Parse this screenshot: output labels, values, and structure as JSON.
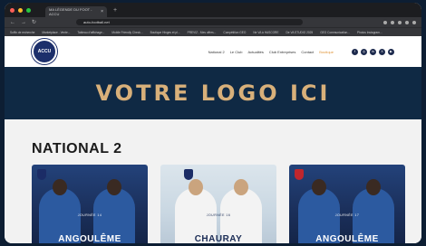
{
  "browser": {
    "tab_title": "MA LÉGENDE DU FOOT - ACCU",
    "url": "auto-football.net",
    "bookmarks": [
      "Suffix de recherche",
      "Marketplace - Vente...",
      "Tableau d'affichage...",
      "Mobile Friendly Check...",
      "Boutique Hinges et pl...",
      "PREVIZ - Mes offres...",
      "Compétition GEO",
      "Ne VA à HASCORE",
      "De VA STUDIO 2025",
      "GEO Communication...",
      "Photos Instagram..."
    ],
    "colors": {
      "close": "#ff5f57",
      "min": "#febc2e",
      "max": "#28c840"
    }
  },
  "site": {
    "logo_text": "ACCU",
    "nav": [
      "National 2",
      "Le Club",
      "Actualités",
      "Club Entreprises",
      "Contact",
      "Boutique"
    ],
    "social_icons": [
      "facebook-icon",
      "instagram-icon",
      "linkedin-icon",
      "x-icon",
      "youtube-icon"
    ]
  },
  "banner": {
    "text": "VOTRE LOGO ICI"
  },
  "section": {
    "title": "NATIONAL 2"
  },
  "cards": [
    {
      "matchday": "JOURNÉE 14",
      "team": "ANGOULÊME"
    },
    {
      "matchday": "JOURNÉE 16",
      "team": "CHAURAY"
    },
    {
      "matchday": "JOURNÉE 17",
      "team": "ANGOULÊME"
    }
  ]
}
